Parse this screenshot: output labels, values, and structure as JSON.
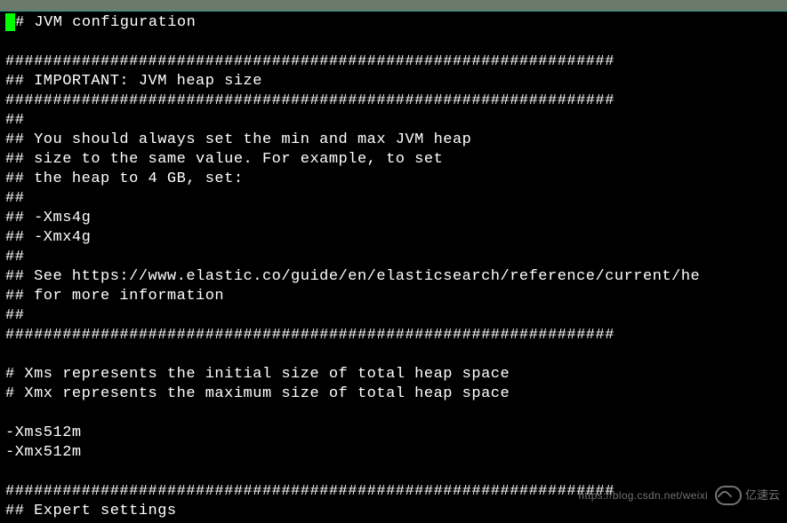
{
  "config": {
    "lines": [
      "# JVM configuration",
      "",
      "################################################################",
      "## IMPORTANT: JVM heap size",
      "################################################################",
      "##",
      "## You should always set the min and max JVM heap",
      "## size to the same value. For example, to set",
      "## the heap to 4 GB, set:",
      "##",
      "## -Xms4g",
      "## -Xmx4g",
      "##",
      "## See https://www.elastic.co/guide/en/elasticsearch/reference/current/he",
      "## for more information",
      "##",
      "################################################################",
      "",
      "# Xms represents the initial size of total heap space",
      "# Xmx represents the maximum size of total heap space",
      "",
      "-Xms512m",
      "-Xmx512m",
      "",
      "################################################################",
      "## Expert settings"
    ]
  },
  "watermark": {
    "url": "https://blog.csdn.net/weixi",
    "brand": "亿速云"
  }
}
